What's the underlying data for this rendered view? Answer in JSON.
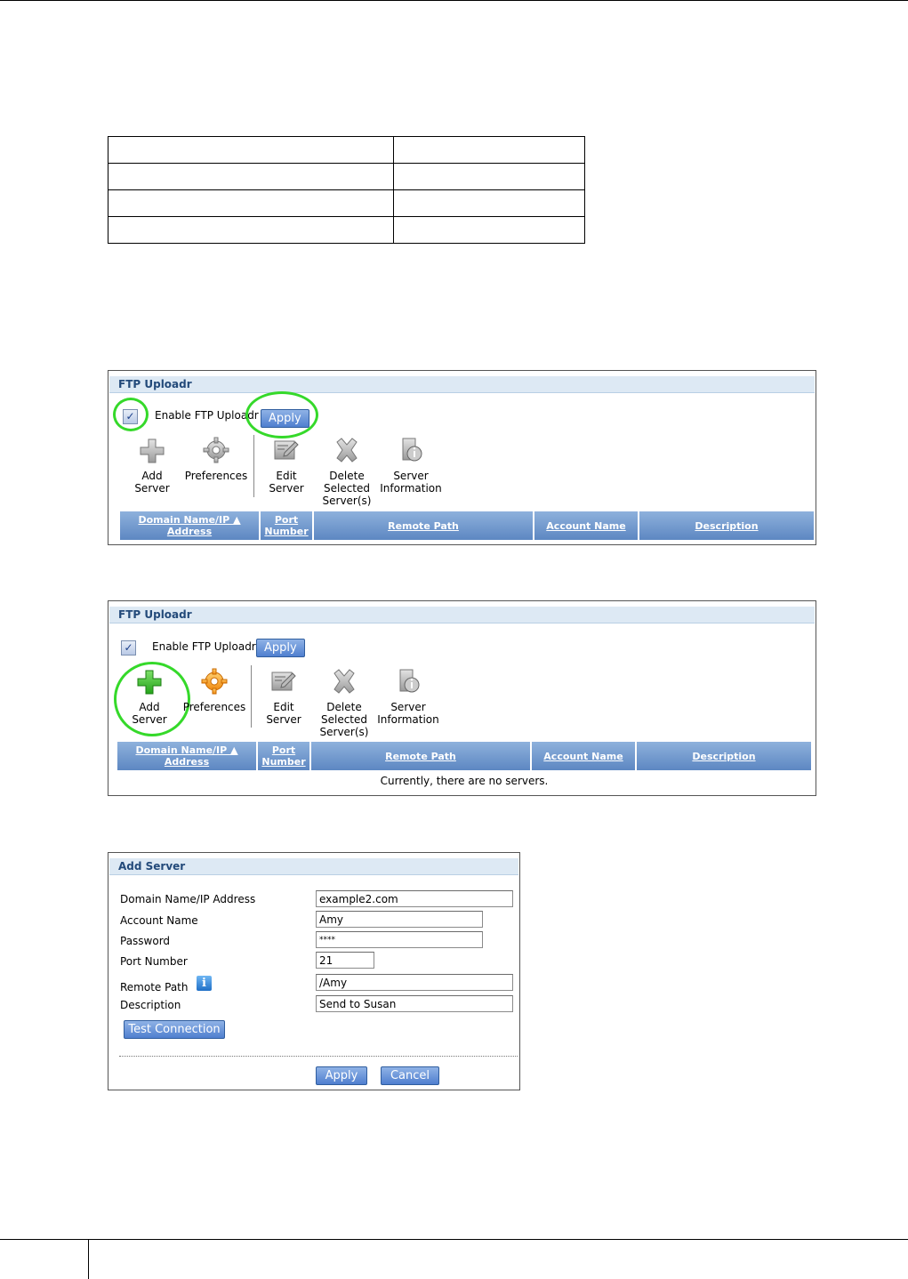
{
  "doc_table": {
    "rows": [
      [
        "",
        ""
      ],
      [
        "",
        ""
      ],
      [
        "",
        ""
      ],
      [
        "",
        ""
      ]
    ]
  },
  "panel1": {
    "title": "FTP Uploadr",
    "enable_label": "Enable FTP Uploadr",
    "apply_label": "Apply",
    "tools": [
      {
        "label": "Add\nServer",
        "icon": "add-server-icon"
      },
      {
        "label": "Preferences",
        "icon": "gear-icon"
      },
      {
        "label": "Edit\nServer",
        "icon": "edit-icon"
      },
      {
        "label": "Delete\nSelected\nServer(s)",
        "icon": "delete-icon"
      },
      {
        "label": "Server\nInformation",
        "icon": "info-icon"
      }
    ],
    "columns": [
      "Domain Name/IP ▲\nAddress",
      "Port\nNumber",
      "Remote Path",
      "Account Name",
      "Description"
    ]
  },
  "panel2": {
    "title": "FTP Uploadr",
    "enable_label": "Enable FTP Uploadr",
    "apply_label": "Apply",
    "tools": [
      {
        "label": "Add\nServer",
        "icon": "add-server-icon"
      },
      {
        "label": "Preferences",
        "icon": "gear-icon"
      },
      {
        "label": "Edit\nServer",
        "icon": "edit-icon"
      },
      {
        "label": "Delete\nSelected\nServer(s)",
        "icon": "delete-icon"
      },
      {
        "label": "Server\nInformation",
        "icon": "info-icon"
      }
    ],
    "columns": [
      "Domain Name/IP ▲\nAddress",
      "Port\nNumber",
      "Remote Path",
      "Account Name",
      "Description"
    ],
    "empty_message": "Currently, there are no servers."
  },
  "add_server": {
    "title": "Add Server",
    "fields": [
      {
        "label": "Domain Name/IP Address",
        "value": "example2.com"
      },
      {
        "label": "Account Name",
        "value": "Amy"
      },
      {
        "label": "Password",
        "value": "****"
      },
      {
        "label": "Port Number",
        "value": "21"
      },
      {
        "label": "Remote Path",
        "value": "/Amy"
      },
      {
        "label": "Description",
        "value": "Send to Susan"
      }
    ],
    "test_button": "Test Connection",
    "apply_button": "Apply",
    "cancel_button": "Cancel"
  },
  "colors": {
    "accent": "#5d87c2",
    "highlight_circle": "#35d92a",
    "title_bg": "#dde9f4"
  }
}
